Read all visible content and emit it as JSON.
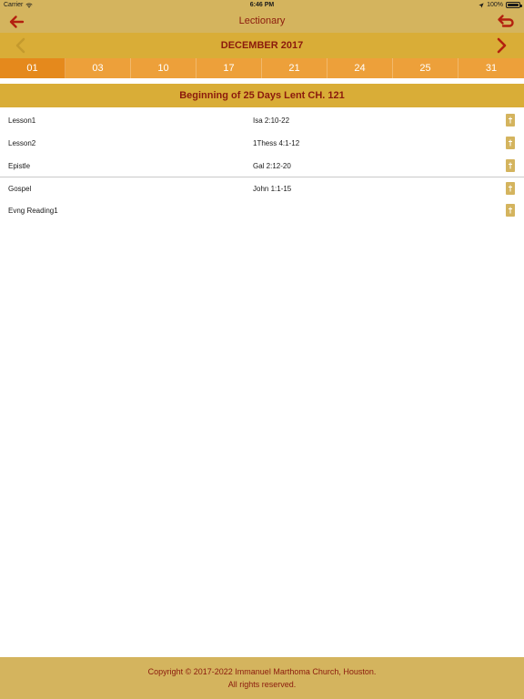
{
  "status_bar": {
    "carrier": "Carrier",
    "time": "6:46 PM",
    "battery": "100%"
  },
  "nav": {
    "title": "Lectionary",
    "back_icon": "arrow-left-icon",
    "undo_icon": "undo-arrow-icon"
  },
  "calendar": {
    "month": "DECEMBER 2017",
    "days": [
      "01",
      "03",
      "10",
      "17",
      "21",
      "24",
      "25",
      "31"
    ],
    "selected": "01"
  },
  "heading": "Beginning of 25 Days Lent CH. 121",
  "readings": [
    {
      "label": "Lesson1",
      "reference": "Isa 2:10-22"
    },
    {
      "label": "Lesson2",
      "reference": "1Thess 4:1-12"
    },
    {
      "label": "Epistle",
      "reference": "Gal 2:12-20"
    },
    {
      "label": "Gospel",
      "reference": "John 1:1-15"
    },
    {
      "label": "Evng Reading1",
      "reference": ""
    }
  ],
  "footer": {
    "line1": "Copyright © 2017-2022 Immanuel Marthoma Church, Houston.",
    "line2": "All rights reserved."
  },
  "colors": {
    "bar": "#d4b45e",
    "month_bar": "#d9ad37",
    "tab": "#eda03a",
    "tab_active": "#e5891c",
    "accent_text": "#8b1a0d"
  }
}
